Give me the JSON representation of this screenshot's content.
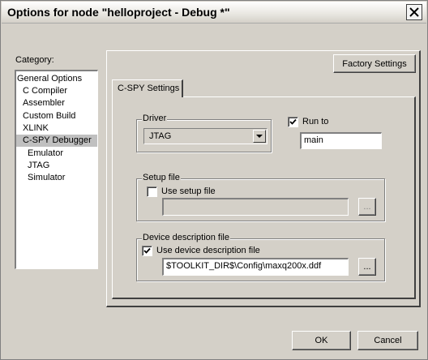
{
  "window": {
    "title": "Options for node \"helloproject - Debug *\""
  },
  "category": {
    "label": "Category:",
    "items": [
      {
        "label": "General Options",
        "indent": 0
      },
      {
        "label": "C Compiler",
        "indent": 1
      },
      {
        "label": "Assembler",
        "indent": 1
      },
      {
        "label": "Custom Build",
        "indent": 1
      },
      {
        "label": "XLINK",
        "indent": 1
      },
      {
        "label": "C-SPY Debugger",
        "indent": 1,
        "selected": true
      },
      {
        "label": "Emulator",
        "indent": 2
      },
      {
        "label": "JTAG",
        "indent": 2
      },
      {
        "label": "Simulator",
        "indent": 2
      }
    ]
  },
  "factory_settings_label": "Factory Settings",
  "tab_label": "C-SPY Settings",
  "driver": {
    "group_label": "Driver",
    "selected": "JTAG"
  },
  "run_to": {
    "label": "Run to",
    "checked": true,
    "value": "main"
  },
  "setup_file": {
    "group_label": "Setup file",
    "checkbox_label": "Use setup file",
    "checked": false,
    "value": "",
    "browse_label": "..."
  },
  "device_description": {
    "group_label": "Device description file",
    "checkbox_label": "Use device description file",
    "checked": true,
    "value": "$TOOLKIT_DIR$\\Config\\maxq200x.ddf",
    "browse_label": "..."
  },
  "ok_label": "OK",
  "cancel_label": "Cancel",
  "colors": {
    "face": "#d4d0c8",
    "selection": "#c0c0c0"
  }
}
